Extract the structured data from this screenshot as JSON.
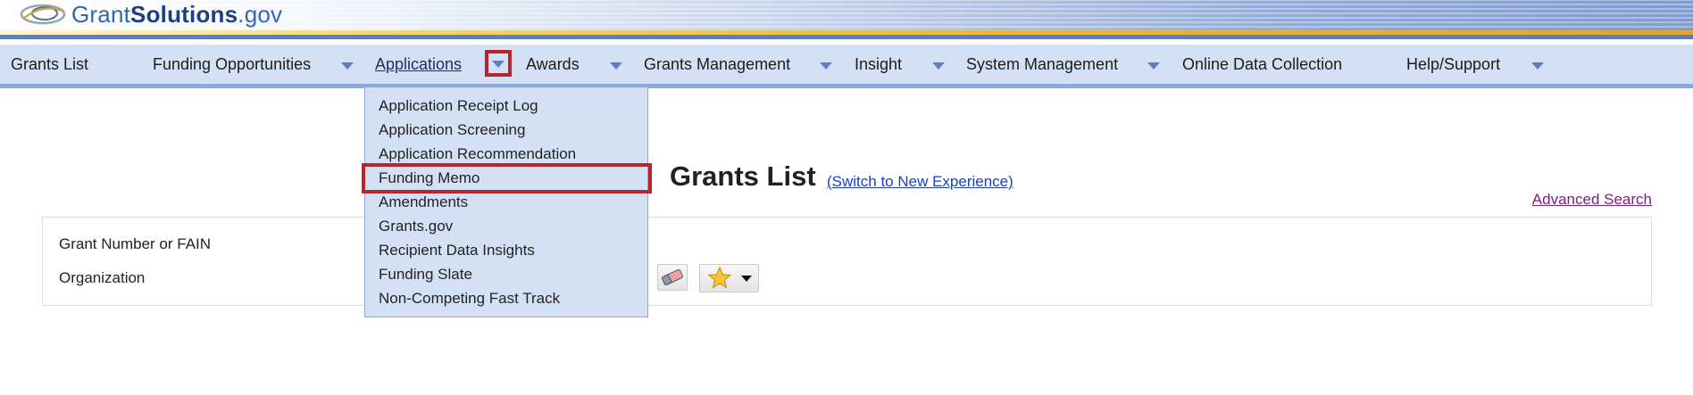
{
  "header": {
    "logo_part1": "Grant",
    "logo_part2": "Solutions",
    "logo_part3": ".gov"
  },
  "nav": {
    "items": [
      {
        "label": "Grants List"
      },
      {
        "label": "Funding Opportunities"
      },
      {
        "label": "Applications"
      },
      {
        "label": "Awards"
      },
      {
        "label": "Grants Management"
      },
      {
        "label": "Insight"
      },
      {
        "label": "System Management"
      },
      {
        "label": "Online Data Collection"
      },
      {
        "label": "Help/Support"
      }
    ]
  },
  "dropdown": {
    "items": [
      {
        "label": "Application Receipt Log"
      },
      {
        "label": "Application Screening"
      },
      {
        "label": "Application Recommendation"
      },
      {
        "label": "Funding Memo"
      },
      {
        "label": "Amendments"
      },
      {
        "label": "Grants.gov"
      },
      {
        "label": "Recipient Data Insights"
      },
      {
        "label": "Funding Slate"
      },
      {
        "label": "Non-Competing Fast Track"
      }
    ]
  },
  "page": {
    "title": "Grants List",
    "switch_link": "(Switch to New Experience)",
    "advanced_search": "Advanced Search"
  },
  "search": {
    "grant_number_label": "Grant Number or FAIN",
    "organization_label": "Organization"
  },
  "colors": {
    "nav_bg": "#d4e1f5",
    "highlight_border": "#b5252f",
    "link": "#1a3ecc",
    "visited_link": "#7a1f7a"
  }
}
